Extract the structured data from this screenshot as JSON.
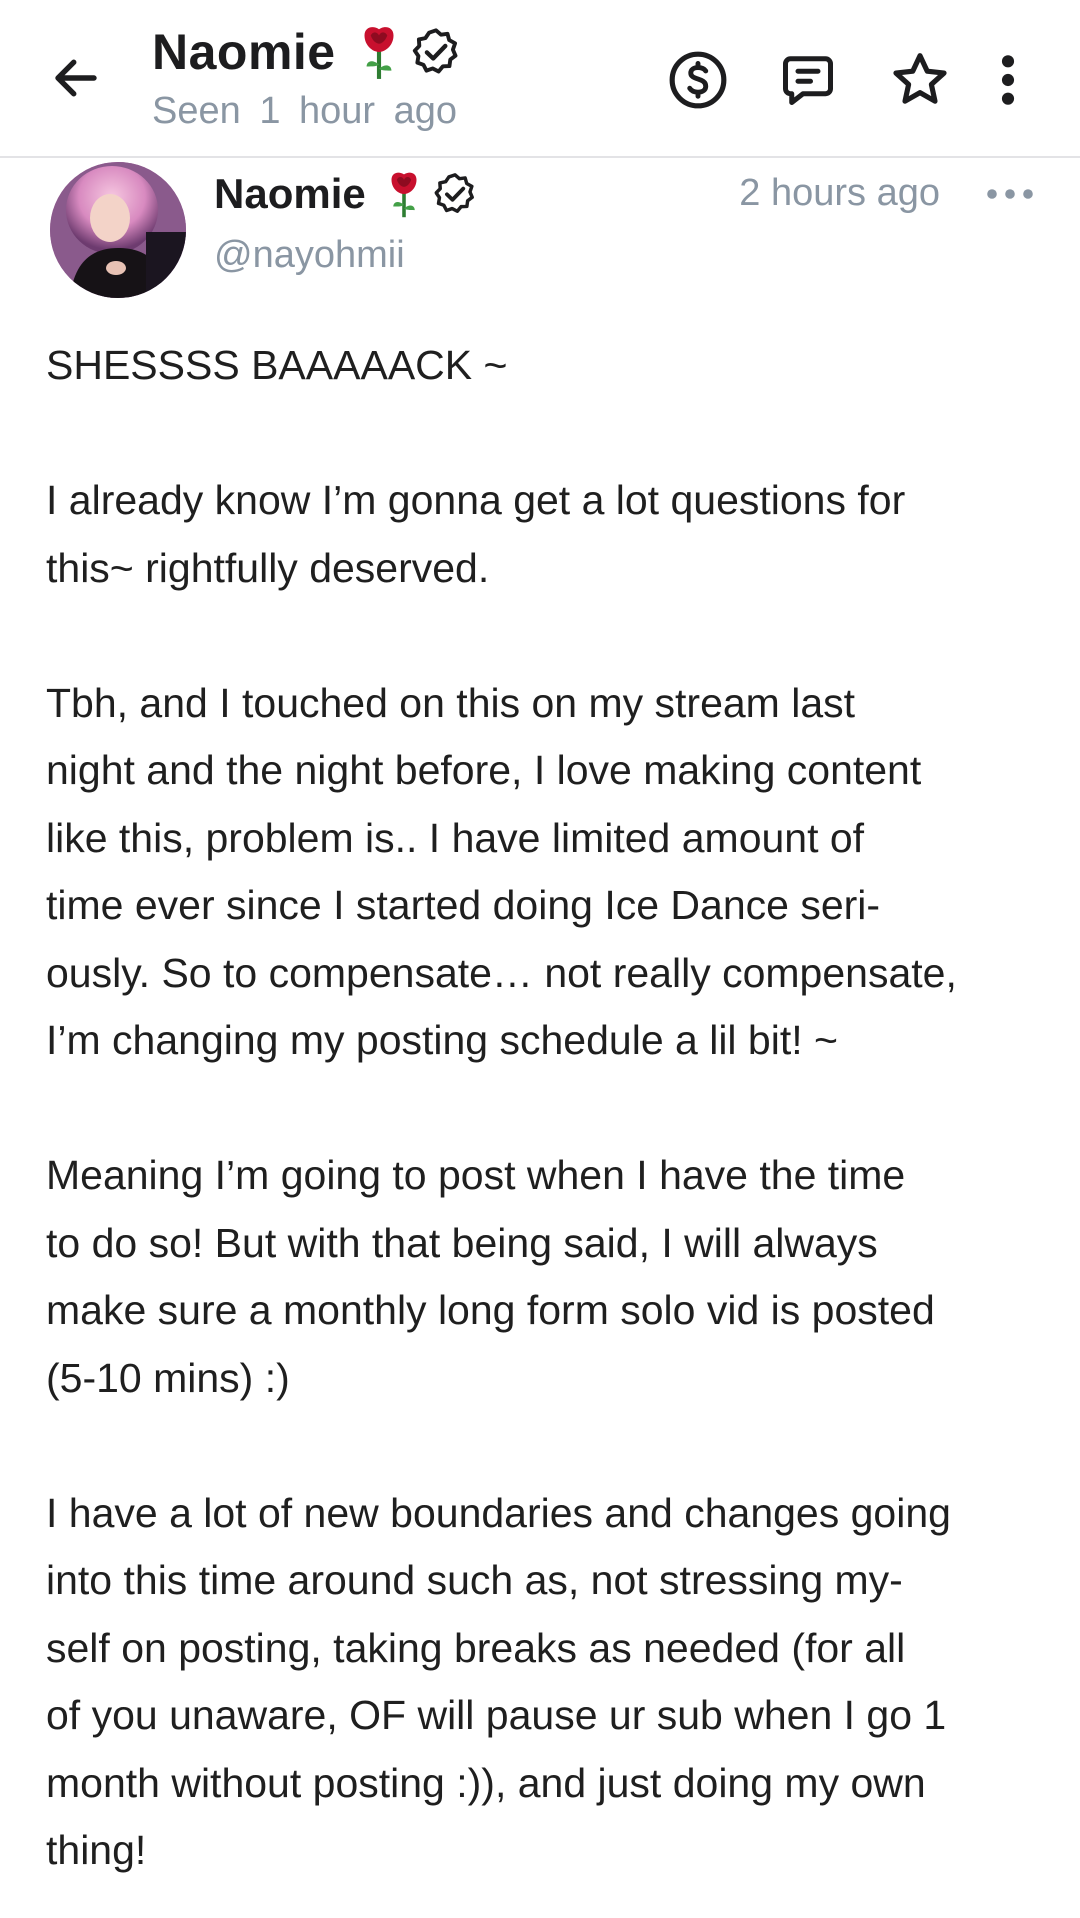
{
  "header": {
    "name": "Naomie",
    "seen_label": "Seen",
    "seen_time": "1 hour ago",
    "icons": {
      "back": "arrow-left-icon",
      "tip": "dollar-circle-icon",
      "message": "message-icon",
      "favorite": "star-icon",
      "more": "more-vertical-icon"
    }
  },
  "post": {
    "author_name": "Naomie",
    "handle": "@nayohmii",
    "timestamp": "2 hours ago",
    "paragraphs": [
      "SHESSSS BAAAAACK ~",
      "I already know I’m gonna get a lot questions for\nthis~ rightfully deserved.",
      "Tbh, and I touched on this on my stream last\nnight and the night before, I love making content\nlike this, problem is.. I have limited amount of\ntime ever since I started doing Ice Dance seri-\nously. So to compensate… not really compensate,\nI’m changing my posting schedule a lil bit! ~",
      "Meaning I’m going to post when I have the time\nto do so! But with that being said, I will always\nmake sure a monthly long form solo vid is posted\n(5-10 mins) :)",
      "I have a lot of new boundaries and changes going\ninto this time around such as, not stressing my-\nself on posting, taking breaks as needed (for all\nof you unaware, OF will pause ur sub when I go 1\nmonth without posting :)), and just doing my own\nthing!"
    ]
  },
  "colors": {
    "text": "#1f1f1f",
    "muted": "#8a96a3",
    "divider": "#e3e3e6",
    "rose": "#c8102e"
  }
}
